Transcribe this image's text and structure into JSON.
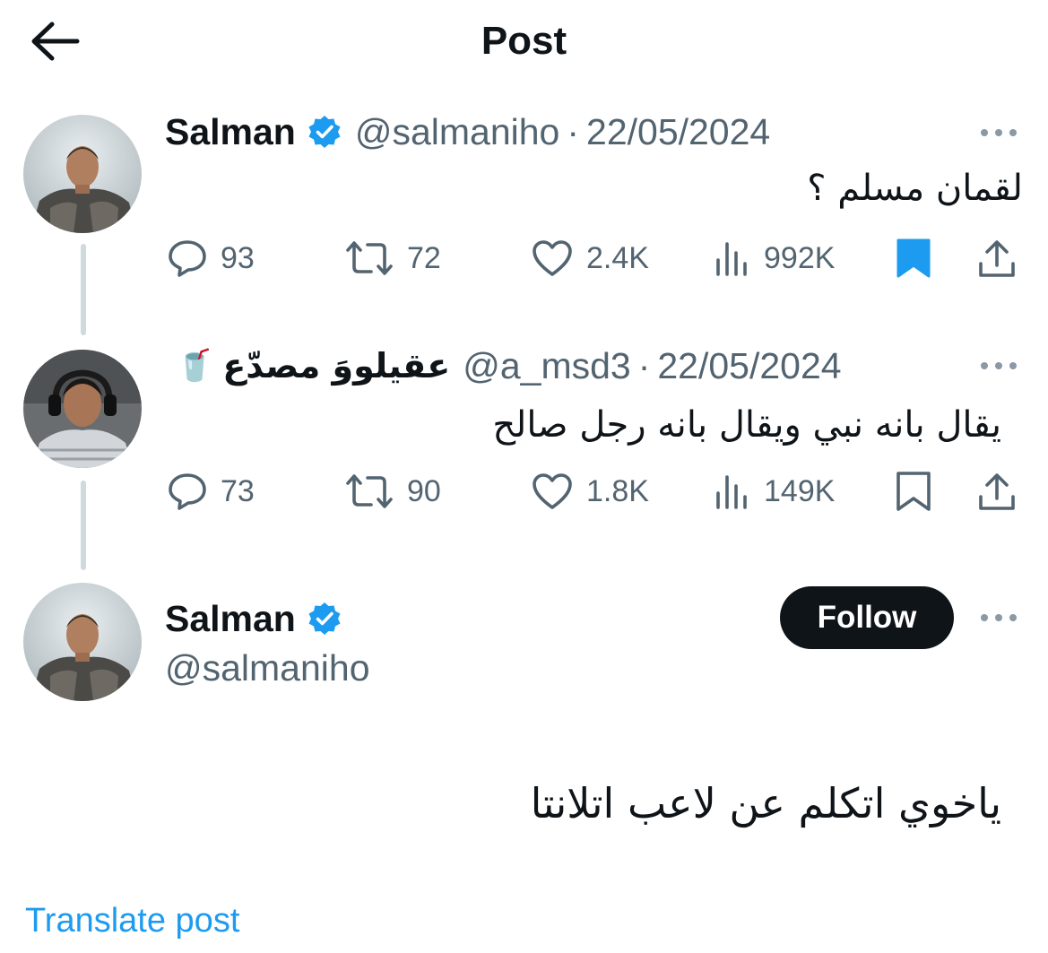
{
  "header": {
    "title": "Post"
  },
  "tweets": [
    {
      "name": "Salman",
      "handle": "@salmaniho",
      "separator": "·",
      "date": "22/05/2024",
      "text": "لقمان مسلم ؟",
      "replies": "93",
      "retweets": "72",
      "likes": "2.4K",
      "views": "992K",
      "bookmarked": true
    },
    {
      "name": "عقيلووَ مصدّع",
      "emoji": "🥤",
      "handle": "@a_msd3",
      "separator": "·",
      "date": "22/05/2024",
      "text": "يقال بانه نبي ويقال بانه رجل صالح",
      "replies": "73",
      "retweets": "90",
      "likes": "1.8K",
      "views": "149K",
      "bookmarked": false
    }
  ],
  "main_post": {
    "name": "Salman",
    "handle": "@salmaniho",
    "follow_label": "Follow",
    "text": "ياخوي اتكلم عن لاعب اتلانتا",
    "translate_label": "Translate post"
  },
  "colors": {
    "text": "#0f1419",
    "secondary": "#536471",
    "accent": "#1d9bf0",
    "thread_line": "#cfd9de"
  }
}
